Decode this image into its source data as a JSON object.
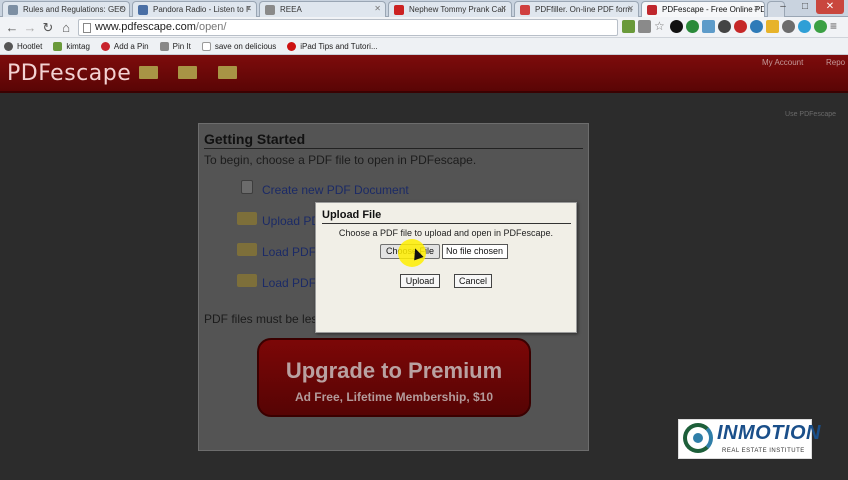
{
  "browser": {
    "tabs": [
      {
        "title": "Rules and Regulations: GEO",
        "color": "#7d8fa3"
      },
      {
        "title": "Pandora Radio - Listen to F",
        "color": "#4a6fa5"
      },
      {
        "title": "REEA",
        "color": "#8a8a8a"
      },
      {
        "title": "Nephew Tommy Prank Call",
        "color": "#cc2222"
      },
      {
        "title": "PDFfiller. On-line PDF form",
        "color": "#d04040"
      },
      {
        "title": "PDFescape - Free Online PD",
        "color": "#c0272d",
        "active": true
      }
    ],
    "window_controls": {
      "minimize": "–",
      "maximize": "□",
      "close": "✕"
    },
    "url": {
      "host": "www.pdfescape.com",
      "path": "/open/"
    },
    "bookmarks": [
      {
        "label": "Hootlet",
        "color": "#555555"
      },
      {
        "label": "kimtag",
        "color": "#6a9a3a"
      },
      {
        "label": "Add a Pin",
        "color": "#c8232c"
      },
      {
        "label": "Pin It",
        "color": "#888888"
      },
      {
        "label": "save on delicious",
        "color": "#666666"
      },
      {
        "label": "iPad Tips and Tutori...",
        "color": "#cc1111"
      }
    ]
  },
  "site": {
    "logo": "PDFescape",
    "header_links": [
      "My Account",
      "Repo"
    ],
    "side_note": "Use PDFescape"
  },
  "panel": {
    "title": "Getting Started",
    "intro": "To begin, choose a PDF file to open in PDFescape.",
    "options": [
      "Create new PDF Document",
      "Upload PDF",
      "Load PDF",
      "Load PDF"
    ],
    "note": "PDF files must be less",
    "premium": {
      "title": "Upgrade to Premium",
      "subtitle": "Ad Free, Lifetime Membership, $10"
    }
  },
  "dialog": {
    "title": "Upload File",
    "message": "Choose a PDF file to upload and open in PDFescape.",
    "choose_label": "Choose File",
    "file_status": "No file chosen",
    "upload_label": "Upload",
    "cancel_label": "Cancel"
  },
  "watermark": {
    "brand": "INMOTION",
    "subtitle": "REAL ESTATE INSTITUTE"
  }
}
